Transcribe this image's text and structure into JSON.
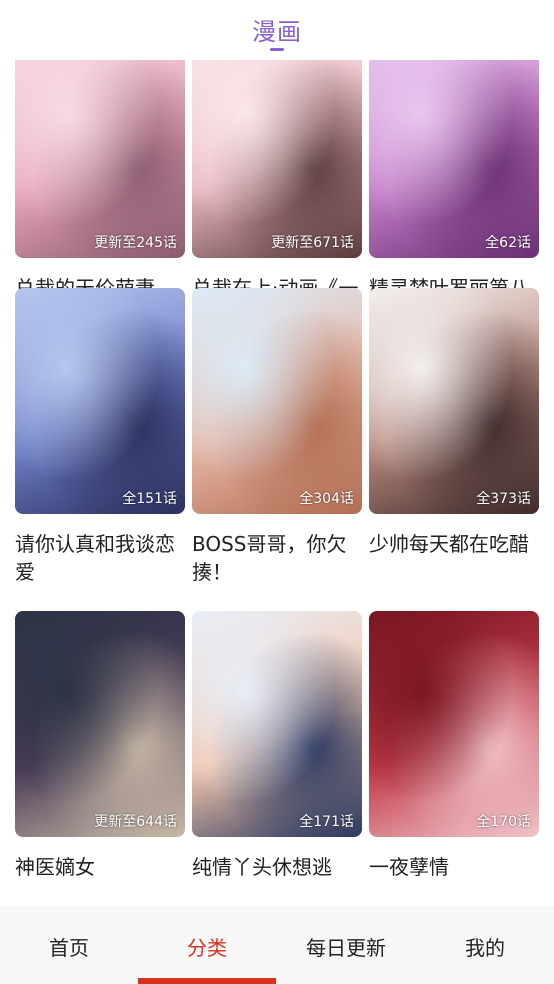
{
  "colors": {
    "accent": "#8a5fd3",
    "active_tab": "#d9311f",
    "text": "#222222",
    "tabbar_bg": "#f7f7f7"
  },
  "header": {
    "title": "漫画"
  },
  "comics": [
    {
      "title": "总裁的天价萌妻",
      "badge": "更新至245话",
      "palette": [
        "#f7dbe4",
        "#e9a6bd",
        "#8c5b6f"
      ]
    },
    {
      "title": "总裁在上·动画《一念时光》...",
      "badge": "更新至671话",
      "palette": [
        "#fbe7ea",
        "#e8b6bf",
        "#5a3b3b"
      ]
    },
    {
      "title": "精灵梦叶罗丽第八季",
      "badge": "全62话",
      "palette": [
        "#e9c7ef",
        "#c57fc9",
        "#6b2f73"
      ]
    },
    {
      "title": "请你认真和我谈恋爱",
      "badge": "全151话",
      "palette": [
        "#b7c6ef",
        "#6e80c8",
        "#2b2f5d"
      ]
    },
    {
      "title": "BOSS哥哥，你欠揍！",
      "badge": "全304话",
      "palette": [
        "#dcebf7",
        "#e7b7a6",
        "#b26d53"
      ]
    },
    {
      "title": "少帅每天都在吃醋",
      "badge": "全373话",
      "palette": [
        "#f3efee",
        "#b98b7f",
        "#3e2a2a"
      ]
    },
    {
      "title": "神医嫡女",
      "badge": "更新至644话",
      "palette": [
        "#2c3345",
        "#4b3c58",
        "#c9b9a6"
      ]
    },
    {
      "title": "纯情丫头休想逃",
      "badge": "全171话",
      "palette": [
        "#e9eef7",
        "#f2c5aa",
        "#2a3860"
      ]
    },
    {
      "title": "一夜孽情",
      "badge": "全170话",
      "palette": [
        "#7a1622",
        "#c23b4a",
        "#f0c3c8"
      ]
    }
  ],
  "tabs": [
    {
      "label": "首页",
      "active": false
    },
    {
      "label": "分类",
      "active": true
    },
    {
      "label": "每日更新",
      "active": false
    },
    {
      "label": "我的",
      "active": false
    }
  ]
}
